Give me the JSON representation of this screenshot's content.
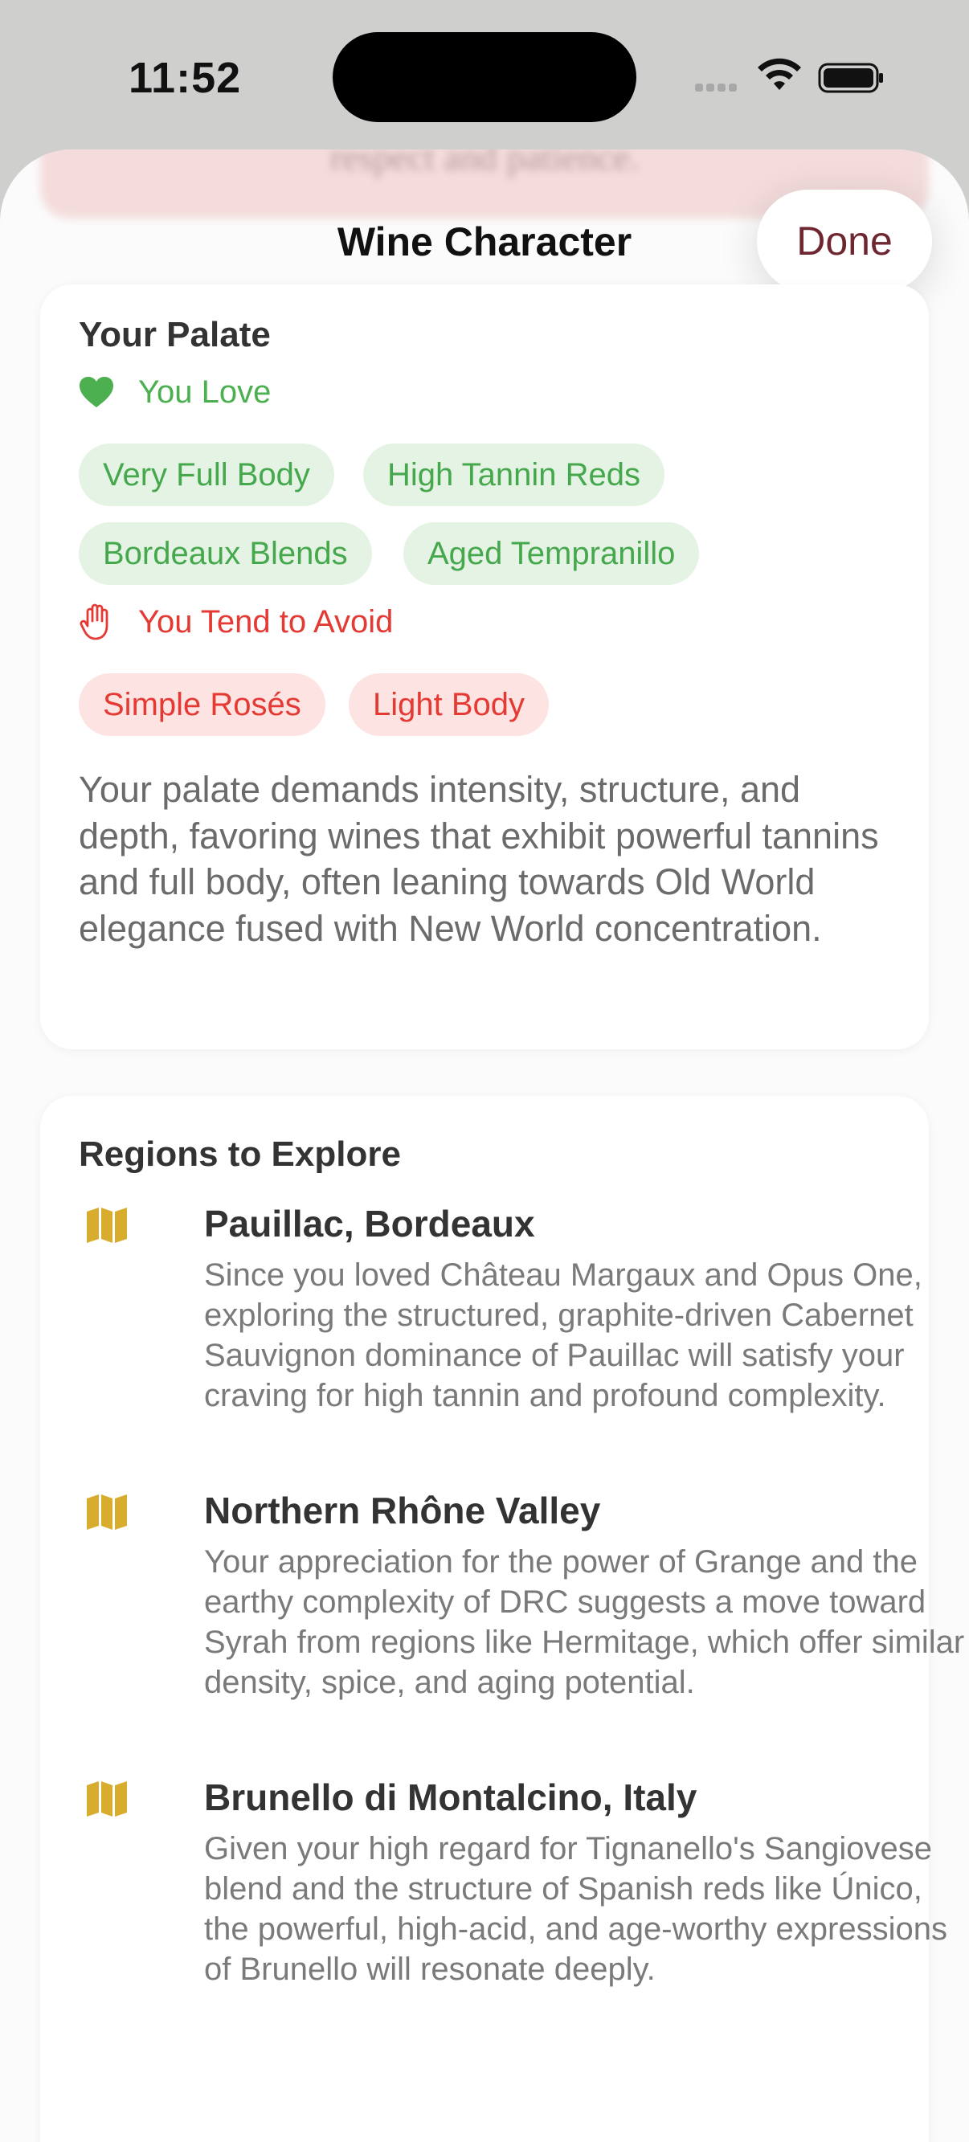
{
  "status_bar": {
    "time": "11:52"
  },
  "sheet": {
    "background_text": "respect and patience.",
    "title": "Wine Character",
    "done_label": "Done"
  },
  "palate": {
    "heading": "Your Palate",
    "love_label": "You Love",
    "love_chips": [
      "Very Full Body",
      "High Tannin Reds",
      "Bordeaux Blends",
      "Aged Tempranillo"
    ],
    "avoid_label": "You Tend to Avoid",
    "avoid_chips": [
      "Simple Rosés",
      "Light Body"
    ],
    "summary": "Your palate demands intensity, structure, and depth, favoring wines that exhibit powerful tannins and full body, often leaning towards Old World elegance fused with New World concentration."
  },
  "regions": {
    "heading": "Regions to Explore",
    "items": [
      {
        "name": "Pauillac, Bordeaux",
        "description": "Since you loved Château Margaux and Opus One, exploring the structured, graphite-driven Cabernet Sauvignon dominance of Pauillac will satisfy your craving for high tannin and profound complexity.",
        "icon": "map-icon"
      },
      {
        "name": "Northern Rhône Valley",
        "description": "Your appreciation for the power of Grange and the earthy complexity of DRC suggests a move toward Syrah from regions like Hermitage, which offer similar density, spice, and aging potential.",
        "icon": "map-icon"
      },
      {
        "name": "Brunello di Montalcino, Italy",
        "description": "Given your high regard for Tignanello's Sangiovese blend and the structure of Spanish reds like Único, the powerful, high-acid, and age-worthy expressions of Brunello will resonate deeply.",
        "icon": "map-icon"
      }
    ]
  },
  "colors": {
    "accent_wine": "#6e2631",
    "love_green": "#4caf50",
    "avoid_red": "#e53a34",
    "map_gold": "#d8ad2e"
  }
}
